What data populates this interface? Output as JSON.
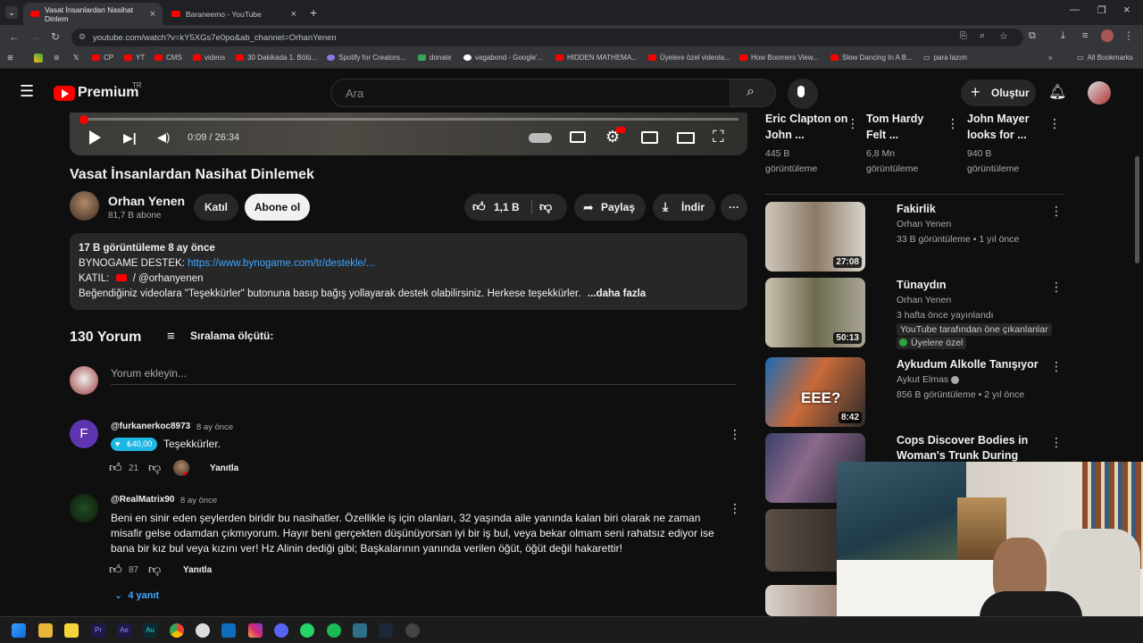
{
  "browser": {
    "tabs": [
      {
        "label": "Vasat İnsanlardan Nasihat Dinlem"
      },
      {
        "label": "Baraneemo - YouTube"
      }
    ],
    "url": "youtube.com/watch?v=kY5XGs7e0po&ab_channel=OrhanYenen",
    "bookmarks": [
      "CP",
      "YT",
      "CMS",
      "videos",
      "30 Dakikada 1. Bölü...",
      "Spotify for Creators...",
      "donate",
      "vagabond - Google'...",
      "HIDDEN MATHEMA...",
      "Üyelere özel videola...",
      "How Boomers View...",
      "Slow Dancing In A B...",
      "para lazım",
      "All Bookmarks"
    ]
  },
  "header": {
    "logo": "Premium",
    "region": "TR",
    "search_placeholder": "Ara",
    "create_label": "Oluştur"
  },
  "player": {
    "time": "0:09 / 26:34",
    "progress_fraction": 0.0056
  },
  "video": {
    "title": "Vasat İnsanlardan Nasihat Dinlemek",
    "channel": "Orhan Yenen",
    "subscribers": "81,7 B abone",
    "join_label": "Katıl",
    "subscribe_label": "Abone ol",
    "likes": "1,1 B",
    "share_label": "Paylaş",
    "download_label": "İndir"
  },
  "description": {
    "stats": "17 B görüntüleme  8 ay önce",
    "line1_prefix": "BYNOGAME DESTEK: ",
    "line1_link": "https://www.bynogame.com/tr/destekle/...",
    "line2_prefix": "KATIL: ",
    "line2_link": " / @orhanyenen",
    "line3": "Beğendiğiniz videolara \"Teşekkürler\" butonuna basıp bağış yollayarak destek olabilirsiniz. Herkese teşekkürler.",
    "more_label": "...daha fazla"
  },
  "comments_section": {
    "count_label": "130 Yorum",
    "sort_label": "Sıralama ölçütü:",
    "add_placeholder": "Yorum ekleyin...",
    "comments": [
      {
        "handle": "@furkanerkoc8973",
        "avatar_letter": "F",
        "time": "8 ay önce",
        "badge": "₺40,00",
        "text": "Teşekkürler.",
        "likes": "21",
        "reply_label": "Yanıtla"
      },
      {
        "handle": "@RealMatrix90",
        "time": "8 ay önce",
        "text": "Beni en sinir eden şeylerden biridir bu nasihatler. Özellikle iş için olanları, 32 yaşında aile yanında kalan biri olarak ne zaman misafir gelse odamdan çıkmıyorum. Hayır beni gerçekten düşünüyorsan iyi bir iş bul, veya bekar olmam seni rahatsız ediyor ise bana bir kız bul veya kızını ver! Hz Alinin dediği gibi; Başkalarının yanında verilen öğüt, öğüt değil hakarettir!",
        "likes": "87",
        "reply_label": "Yanıtla",
        "replies_label": "4 yanıt"
      }
    ]
  },
  "sidebar": {
    "top_row": [
      {
        "title": "Eric Clapton on John ...",
        "views": "445 B görüntüleme"
      },
      {
        "title": "Tom Hardy Felt ...",
        "views": "6,8 Mn görüntüleme"
      },
      {
        "title": "John Mayer looks for ...",
        "views": "940 B görüntüleme"
      }
    ],
    "items": [
      {
        "title": "Fakirlik",
        "channel": "Orhan Yenen",
        "meta": "33 B görüntüleme  • 1 yıl önce",
        "duration": "27:08"
      },
      {
        "title": "Tünaydın",
        "channel": "Orhan Yenen",
        "meta": "3 hafta önce yayınlandı",
        "badge1": "YouTube tarafından öne çıkanlanlar",
        "badge2": "Üyelere özel",
        "duration": "50:13"
      },
      {
        "title": "Aykudum Alkolle Tanışıyor",
        "channel": "Aykut Elmas",
        "meta": "856 B görüntüleme  • 2 yıl önce",
        "duration": "8:42",
        "thumb_text": "EEE?"
      },
      {
        "title": "Cops Discover Bodies in Woman's Trunk During Traffic ...",
        "channel": "",
        "meta": ""
      }
    ]
  },
  "colors": {
    "accent": "#ff0000",
    "link": "#3ea6ff",
    "bg": "#0f0f0f"
  }
}
